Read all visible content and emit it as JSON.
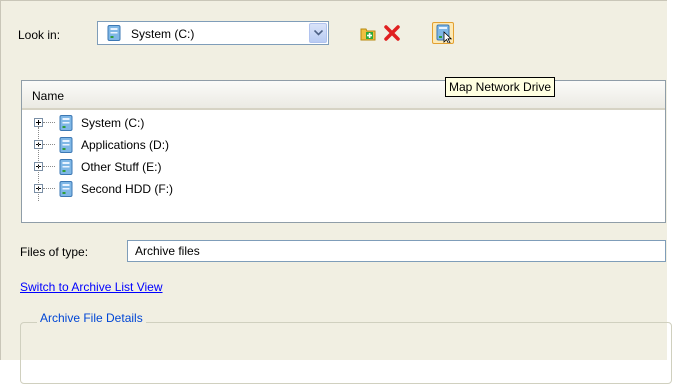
{
  "look_in": {
    "label": "Look in:",
    "selected": "System (C:)",
    "icon": "drive-icon"
  },
  "toolbar": {
    "new_folder_icon": "new-folder-icon",
    "delete_icon": "delete-icon",
    "map_network_drive_icon": "map-network-drive-icon"
  },
  "tooltip": {
    "text": "Map Network Drive"
  },
  "tree": {
    "column_header": "Name",
    "items": [
      {
        "label": "System (C:)"
      },
      {
        "label": "Applications (D:)"
      },
      {
        "label": "Other Stuff (E:)"
      },
      {
        "label": "Second HDD (F:)"
      }
    ]
  },
  "files_of_type": {
    "label": "Files of type:",
    "value": "Archive files"
  },
  "switch_link": "Switch to Archive List View",
  "details_group": {
    "title": "Archive File Details"
  },
  "colors": {
    "panel": "#f1efe2",
    "link": "#0000ff",
    "group_title": "#0046d5"
  }
}
